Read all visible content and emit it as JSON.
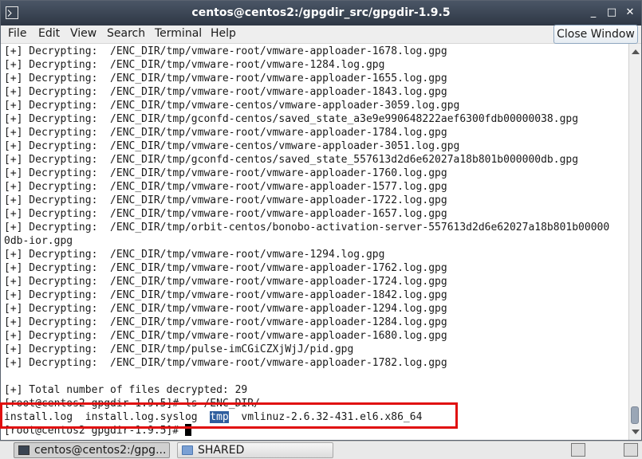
{
  "window": {
    "title": "centos@centos2:/gpgdir_src/gpgdir-1.9.5",
    "controls": {
      "minimize": "_",
      "maximize": "□",
      "close": "✕"
    }
  },
  "menu": [
    "File",
    "Edit",
    "View",
    "Search",
    "Terminal",
    "Help"
  ],
  "close_window_button": "Close Window",
  "terminal": {
    "lines": [
      "[+] Decrypting:  /ENC_DIR/tmp/vmware-root/vmware-apploader-1678.log.gpg",
      "[+] Decrypting:  /ENC_DIR/tmp/vmware-root/vmware-1284.log.gpg",
      "[+] Decrypting:  /ENC_DIR/tmp/vmware-root/vmware-apploader-1655.log.gpg",
      "[+] Decrypting:  /ENC_DIR/tmp/vmware-root/vmware-apploader-1843.log.gpg",
      "[+] Decrypting:  /ENC_DIR/tmp/vmware-centos/vmware-apploader-3059.log.gpg",
      "[+] Decrypting:  /ENC_DIR/tmp/gconfd-centos/saved_state_a3e9e990648222aef6300fdb00000038.gpg",
      "[+] Decrypting:  /ENC_DIR/tmp/vmware-root/vmware-apploader-1784.log.gpg",
      "[+] Decrypting:  /ENC_DIR/tmp/vmware-centos/vmware-apploader-3051.log.gpg",
      "[+] Decrypting:  /ENC_DIR/tmp/gconfd-centos/saved_state_557613d2d6e62027a18b801b000000db.gpg",
      "[+] Decrypting:  /ENC_DIR/tmp/vmware-root/vmware-apploader-1760.log.gpg",
      "[+] Decrypting:  /ENC_DIR/tmp/vmware-root/vmware-apploader-1577.log.gpg",
      "[+] Decrypting:  /ENC_DIR/tmp/vmware-root/vmware-apploader-1722.log.gpg",
      "[+] Decrypting:  /ENC_DIR/tmp/vmware-root/vmware-apploader-1657.log.gpg",
      "[+] Decrypting:  /ENC_DIR/tmp/orbit-centos/bonobo-activation-server-557613d2d6e62027a18b801b00000",
      "0db-ior.gpg",
      "[+] Decrypting:  /ENC_DIR/tmp/vmware-root/vmware-1294.log.gpg",
      "[+] Decrypting:  /ENC_DIR/tmp/vmware-root/vmware-apploader-1762.log.gpg",
      "[+] Decrypting:  /ENC_DIR/tmp/vmware-root/vmware-apploader-1724.log.gpg",
      "[+] Decrypting:  /ENC_DIR/tmp/vmware-root/vmware-apploader-1842.log.gpg",
      "[+] Decrypting:  /ENC_DIR/tmp/vmware-root/vmware-apploader-1294.log.gpg",
      "[+] Decrypting:  /ENC_DIR/tmp/vmware-root/vmware-apploader-1284.log.gpg",
      "[+] Decrypting:  /ENC_DIR/tmp/vmware-root/vmware-apploader-1680.log.gpg",
      "[+] Decrypting:  /ENC_DIR/tmp/pulse-imCGiCZXjWjJ/pid.gpg",
      "[+] Decrypting:  /ENC_DIR/tmp/vmware-root/vmware-apploader-1782.log.gpg",
      "",
      "[+] Total number of files decrypted: 29",
      "[root@centos2 gpgdir-1.9.5]# ls /ENC_DIR/"
    ],
    "ls_output": {
      "before": "install.log  install.log.syslog  ",
      "highlighted": "tmp",
      "after": "  vmlinuz-2.6.32-431.el6.x86_64"
    },
    "prompt": "[root@centos2 gpgdir-1.9.5]# "
  },
  "taskbar": {
    "items": [
      {
        "label": "centos@centos2:/gpg...",
        "icon": "terminal-icon",
        "active": true
      },
      {
        "label": "SHARED",
        "icon": "folder-icon",
        "active": false
      }
    ],
    "tray": [
      "terminal-tray-icon",
      "display-tray-icon"
    ]
  },
  "colors": {
    "titlebar": "#2e3744",
    "highlight": "#2f5e9e",
    "annotation_box": "#e01010"
  }
}
